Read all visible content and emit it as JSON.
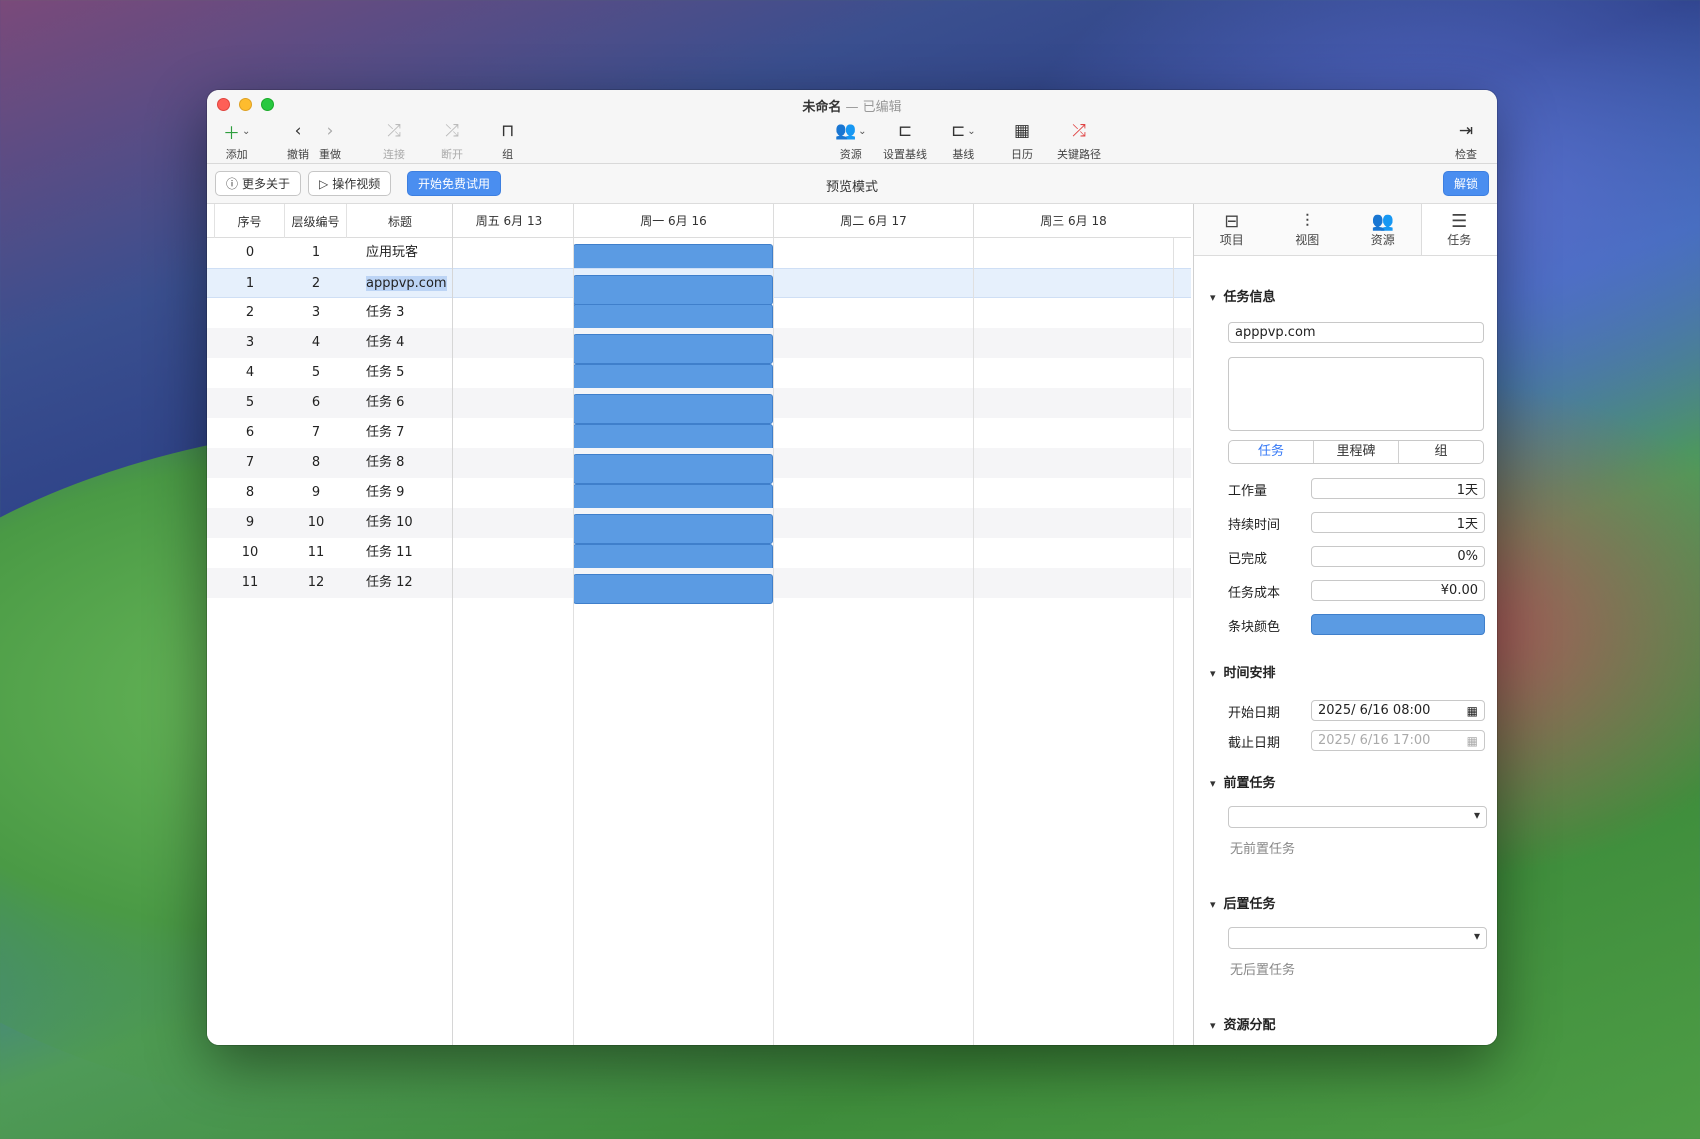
{
  "window": {
    "title": "未命名",
    "title_sep": " — ",
    "title_status": "已编辑"
  },
  "toolbar": {
    "add": "添加",
    "undo": "撤销",
    "redo": "重做",
    "link": "连接",
    "unlink": "断开",
    "group": "组",
    "resource": "资源",
    "set_baseline": "设置基线",
    "baseline": "基线",
    "calendar": "日历",
    "critical_path": "关键路径",
    "inspect": "检查"
  },
  "infobar": {
    "more_about": "更多关于",
    "video": "操作视频",
    "trial": "开始免费试用",
    "mode": "预览模式",
    "unlock": "解锁"
  },
  "table": {
    "headers": {
      "seq": "序号",
      "level": "层级编号",
      "title": "标题"
    },
    "rows": [
      {
        "seq": "0",
        "level": "1",
        "title": "应用玩客"
      },
      {
        "seq": "1",
        "level": "2",
        "title": "apppvp.com"
      },
      {
        "seq": "2",
        "level": "3",
        "title": "任务 3"
      },
      {
        "seq": "3",
        "level": "4",
        "title": "任务 4"
      },
      {
        "seq": "4",
        "level": "5",
        "title": "任务 5"
      },
      {
        "seq": "5",
        "level": "6",
        "title": "任务 6"
      },
      {
        "seq": "6",
        "level": "7",
        "title": "任务 7"
      },
      {
        "seq": "7",
        "level": "8",
        "title": "任务 8"
      },
      {
        "seq": "8",
        "level": "9",
        "title": "任务 9"
      },
      {
        "seq": "9",
        "level": "10",
        "title": "任务 10"
      },
      {
        "seq": "10",
        "level": "11",
        "title": "任务 11"
      },
      {
        "seq": "11",
        "level": "12",
        "title": "任务 12"
      }
    ]
  },
  "gantt": {
    "days": [
      "周五 6月 13",
      "周一 6月 16",
      "周二 6月 17",
      "周三 6月 18"
    ],
    "bar_color": "#5b9be3"
  },
  "inspector": {
    "tabs": [
      "项目",
      "视图",
      "资源",
      "任务"
    ],
    "sec_task_info": "任务信息",
    "task_name": "apppvp.com",
    "types": [
      "任务",
      "里程碑",
      "组"
    ],
    "work_label": "工作量",
    "work": "1天",
    "duration_label": "持续时间",
    "duration": "1天",
    "complete_label": "已完成",
    "complete": "0%",
    "cost_label": "任务成本",
    "cost": "¥0.00",
    "color_label": "条块颜色",
    "sec_schedule": "时间安排",
    "start_label": "开始日期",
    "start": "2025/ 6/16 08:00",
    "end_label": "截止日期",
    "end": "2025/ 6/16 17:00",
    "sec_pred": "前置任务",
    "no_pred": "无前置任务",
    "sec_succ": "后置任务",
    "no_succ": "无后置任务",
    "sec_res": "资源分配"
  }
}
